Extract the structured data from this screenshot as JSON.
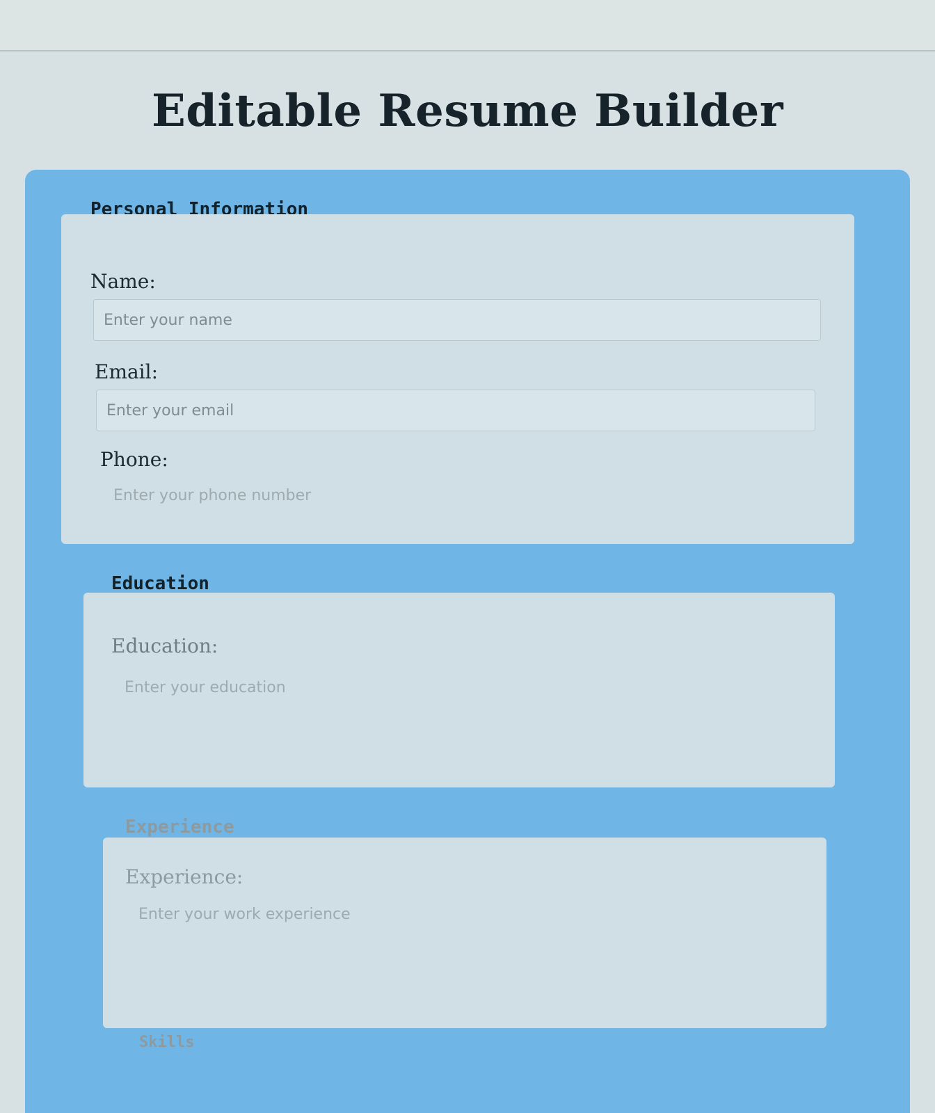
{
  "page": {
    "title": "Editable Resume Builder"
  },
  "sections": {
    "personal": {
      "title": "Personal Information",
      "name_label": "Name:",
      "name_placeholder": "Enter your name",
      "email_label": "Email:",
      "email_placeholder": "Enter your email",
      "phone_label": "Phone:",
      "phone_placeholder": "Enter your phone number"
    },
    "education": {
      "title": "Education",
      "label": "Education:",
      "placeholder": "Enter your education"
    },
    "experience": {
      "title": "Experience",
      "label": "Experience:",
      "placeholder": "Enter your work experience"
    },
    "skills": {
      "title": "Skills"
    }
  },
  "colors": {
    "frame": "#6fb5e6",
    "section_bg": "#cfdfe5",
    "title_text": "#17232a"
  }
}
